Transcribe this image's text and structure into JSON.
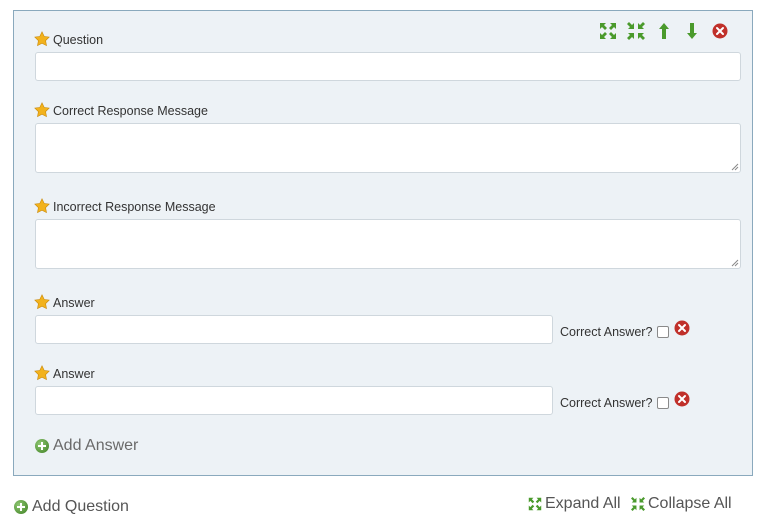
{
  "question_block": {
    "question_label": "Question",
    "question_value": "",
    "correct_msg_label": "Correct Response Message",
    "correct_msg_value": "",
    "incorrect_msg_label": "Incorrect Response Message",
    "incorrect_msg_value": "",
    "answers": [
      {
        "label": "Answer",
        "value": "",
        "correct_label": "Correct Answer?",
        "checked": false
      },
      {
        "label": "Answer",
        "value": "",
        "correct_label": "Correct Answer?",
        "checked": false
      }
    ],
    "add_answer_label": "Add Answer",
    "toolbar_icons": [
      "expand-icon",
      "collapse-icon",
      "move-up-icon",
      "move-down-icon",
      "delete-icon"
    ]
  },
  "footer": {
    "add_question_label": "Add Question",
    "expand_all_label": "Expand All",
    "collapse_all_label": "Collapse All"
  },
  "colors": {
    "panel_bg": "#edf2f6",
    "panel_border": "#8aa9bd",
    "green": "#4a9a2c",
    "red": "#c0302a",
    "star": "#f2b21c"
  }
}
